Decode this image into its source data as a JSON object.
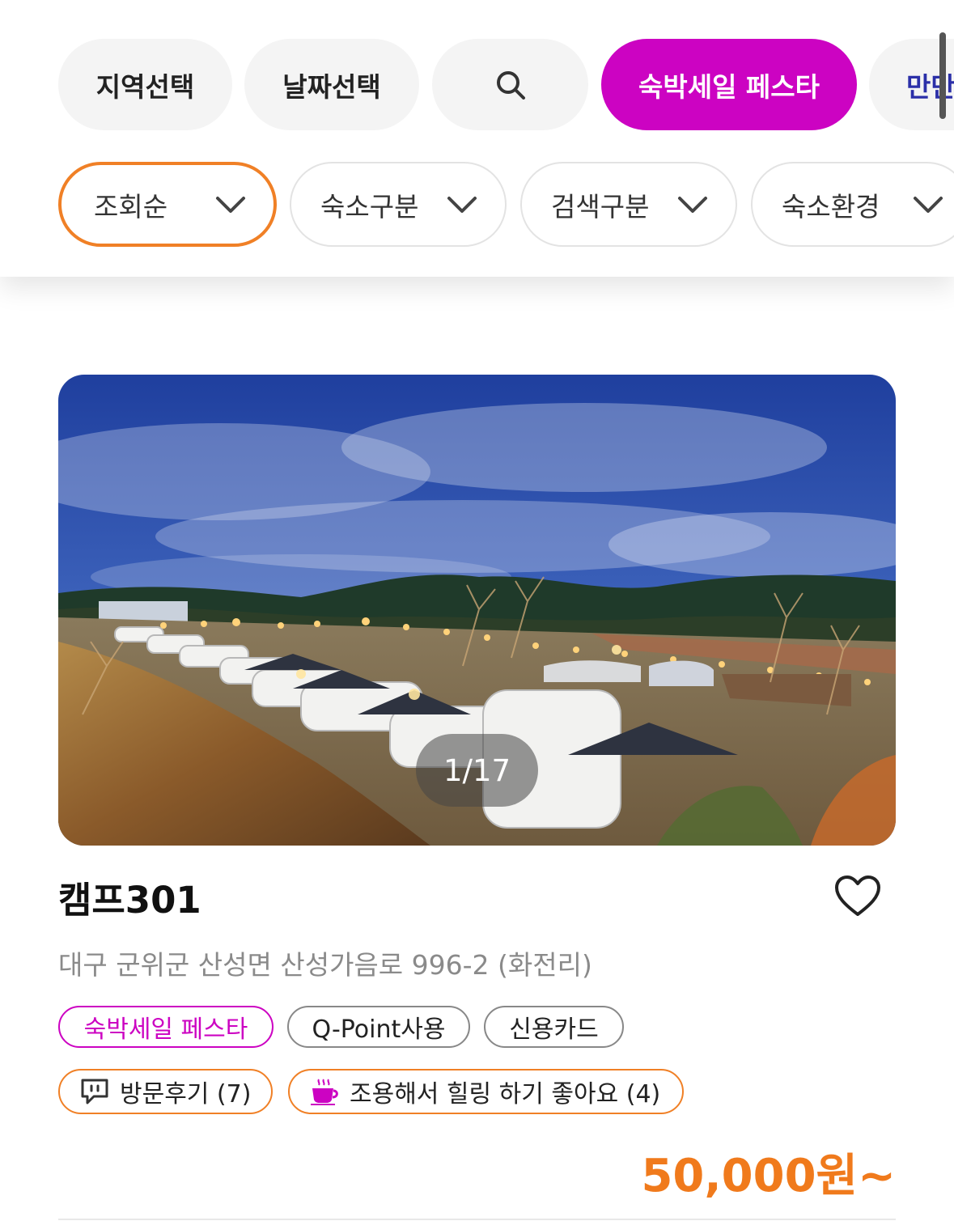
{
  "top_chips": {
    "region": "지역선택",
    "date": "날짜선택",
    "festa": "숙박세일 페스타",
    "more": "만만"
  },
  "filters": {
    "sort": "조회순",
    "lodging_type": "숙소구분",
    "search_type": "검색구분",
    "environment": "숙소환경"
  },
  "listing": {
    "photo_counter": "1/17",
    "title": "캠프301",
    "address": "대구 군위군 산성면 산성가음로 996-2 (화전리)",
    "tags": [
      "숙박세일 페스타",
      "Q-Point사용",
      "신용카드"
    ],
    "reviews_label": "방문후기 (7)",
    "keyword_label": "조용해서 힐링 하기 좋아요 (4)",
    "price": "50,000원~"
  },
  "colors": {
    "accent_magenta": "#cc03c2",
    "accent_orange": "#f08026",
    "price_orange": "#f07a1c"
  },
  "icons": [
    "search-icon",
    "chevron-down-icon",
    "heart-icon",
    "speech-bubble-icon",
    "coffee-cup-icon"
  ]
}
